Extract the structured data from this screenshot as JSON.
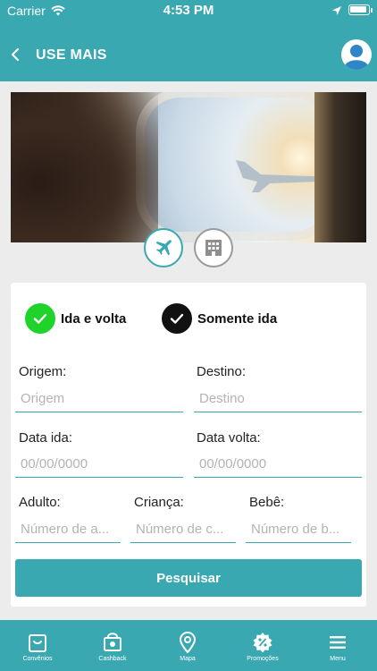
{
  "status_bar": {
    "carrier": "Carrier",
    "time": "4:53 PM"
  },
  "header": {
    "title": "USE MAIS"
  },
  "search_type": {
    "flight_icon": "airplane-icon",
    "hotel_icon": "hotel-building-icon",
    "selected": "flight"
  },
  "trip_type": {
    "roundtrip_label": "Ida e volta",
    "oneway_label": "Somente ida",
    "roundtrip_color": "#1fd32a",
    "oneway_color": "#111111"
  },
  "form": {
    "origin": {
      "label": "Origem:",
      "placeholder": "Origem",
      "value": ""
    },
    "destination": {
      "label": "Destino:",
      "placeholder": "Destino",
      "value": ""
    },
    "departure": {
      "label": "Data ida:",
      "placeholder": "00/00/0000",
      "value": ""
    },
    "return": {
      "label": "Data volta:",
      "placeholder": "00/00/0000",
      "value": ""
    },
    "adult": {
      "label": "Adulto:",
      "placeholder": "Número de a...",
      "value": ""
    },
    "child": {
      "label": "Criança:",
      "placeholder": "Número de c...",
      "value": ""
    },
    "baby": {
      "label": "Bebê:",
      "placeholder": "Número de b...",
      "value": ""
    },
    "submit_label": "Pesquisar"
  },
  "tabbar": {
    "items": [
      {
        "label": "Convênios",
        "icon": "shopping-bag-icon"
      },
      {
        "label": "Cashback",
        "icon": "cashback-icon"
      },
      {
        "label": "Mapa",
        "icon": "map-pin-icon"
      },
      {
        "label": "Promoções",
        "icon": "discount-badge-icon"
      },
      {
        "label": "Menu",
        "icon": "hamburger-menu-icon"
      }
    ]
  },
  "colors": {
    "primary": "#3aa8b1",
    "background": "#ececec",
    "card": "#ffffff"
  }
}
